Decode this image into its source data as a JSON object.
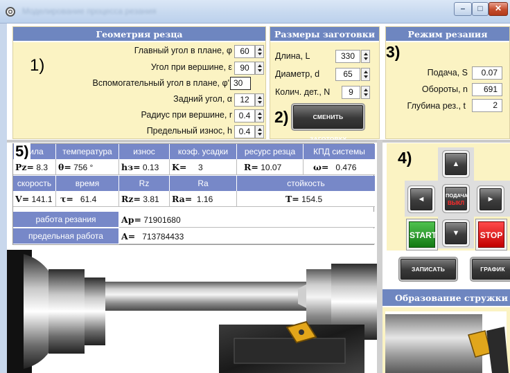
{
  "window": {
    "title": "Моделирование процесса резания",
    "min_symbol": "–",
    "max_symbol": "□",
    "close_symbol": "✕"
  },
  "geometry": {
    "header": "Геометрия резца",
    "marker": "1)",
    "rows": [
      {
        "label": "Главный угол в плане, φ",
        "value": "60"
      },
      {
        "label": "Угол при вершине, ε",
        "value": "90"
      },
      {
        "label": "Вспомогательный угол в плане, φ'",
        "value": "30"
      },
      {
        "label": "Задний угол, α",
        "value": "12"
      },
      {
        "label": "Радиус при вершине, r",
        "value": "0.4"
      },
      {
        "label": "Предельный износ, h",
        "value": "0.4"
      }
    ]
  },
  "workpiece": {
    "header": "Размеры заготовки",
    "marker": "2)",
    "rows": [
      {
        "label": "Длина, L",
        "value": "330"
      },
      {
        "label": "Диаметр, d",
        "value": "65"
      },
      {
        "label": "Колич. дет., N",
        "value": "9"
      }
    ],
    "change_button": "СМЕНИТЬ ЗАГОТОВКУ"
  },
  "cutting_mode": {
    "header": "Режим резания",
    "marker": "3)",
    "rows": [
      {
        "label": "Подача, S",
        "value": "0.07"
      },
      {
        "label": "Обороты, n",
        "value": "691"
      },
      {
        "label": "Глубина рез., t",
        "value": "2"
      }
    ]
  },
  "results": {
    "marker": "5)",
    "headers1": [
      "сила",
      "температура",
      "износ",
      "коэф. усадки",
      "ресурс резца",
      "КПД системы"
    ],
    "values1": [
      {
        "sym": "Pz=",
        "val": "8.3"
      },
      {
        "sym": "θ=",
        "val": "756  °"
      },
      {
        "sym": "hз=",
        "val": "0.13"
      },
      {
        "sym": "K=",
        "val": "3"
      },
      {
        "sym": "R=",
        "val": "10.07"
      },
      {
        "sym": "ω=",
        "val": "0.476"
      }
    ],
    "headers2": [
      "скорость",
      "время",
      "Rz",
      "Ra",
      "стойкость"
    ],
    "values2": [
      {
        "sym": "V=",
        "val": "141.1"
      },
      {
        "sym": "τ=",
        "val": "61.4"
      },
      {
        "sym": "Rz=",
        "val": "3.81"
      },
      {
        "sym": "Ra=",
        "val": "1.16"
      },
      {
        "sym": "T=",
        "val": "154.5"
      }
    ],
    "work_label": "работа резания",
    "work_sym": "Ap=",
    "work_value": "71901680",
    "limit_label": "предельная работа",
    "limit_sym": "A=",
    "limit_value": "713784433"
  },
  "controls": {
    "marker": "4)",
    "up": "▲",
    "down": "▼",
    "left": "◄",
    "right": "►",
    "feed_label": "ПОДАЧА",
    "feed_state": "ВЫКЛ",
    "start": "START",
    "stop": "STOP",
    "record": "ЗАПИСАТЬ",
    "chart": "ГРАФИК"
  },
  "chip_panel": {
    "header": "Образование стружки"
  }
}
